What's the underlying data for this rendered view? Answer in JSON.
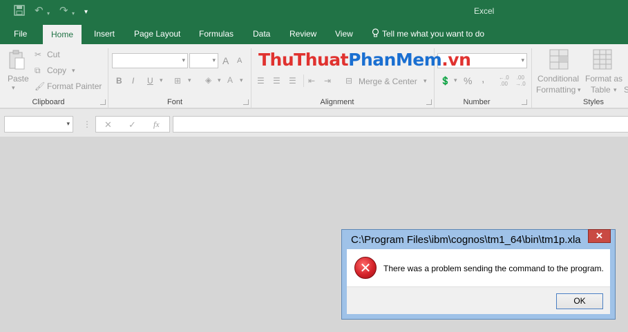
{
  "app": {
    "title": "Excel"
  },
  "qat": {
    "save_icon": "save-icon",
    "undo_icon": "undo-icon",
    "redo_icon": "redo-icon",
    "customize_icon": "customize-qat-icon"
  },
  "tabs": [
    {
      "label": "File"
    },
    {
      "label": "Home"
    },
    {
      "label": "Insert"
    },
    {
      "label": "Page Layout"
    },
    {
      "label": "Formulas"
    },
    {
      "label": "Data"
    },
    {
      "label": "Review"
    },
    {
      "label": "View"
    }
  ],
  "tell_me": "Tell me what you want to do",
  "ribbon": {
    "clipboard": {
      "label": "Clipboard",
      "paste": "Paste",
      "cut": "Cut",
      "copy": "Copy",
      "format_painter": "Format Painter"
    },
    "font": {
      "label": "Font",
      "bold": "B",
      "italic": "I",
      "underline": "U",
      "grow": "A",
      "shrink": "A"
    },
    "alignment": {
      "label": "Alignment",
      "merge_center": "Merge & Center"
    },
    "number": {
      "label": "Number",
      "percent": "%",
      "comma": ","
    },
    "styles": {
      "label": "Styles",
      "conditional_1": "Conditional",
      "conditional_2": "Formatting",
      "format_as_1": "Format as",
      "format_as_2": "Table",
      "cut_off": "S"
    }
  },
  "watermark": {
    "part1": "ThuThuat",
    "part2": "PhanMem",
    "part3": ".vn"
  },
  "formula_bar": {
    "fx": "fx",
    "cancel": "✕",
    "enter": "✓"
  },
  "dialog": {
    "title": "C:\\Program Files\\ibm\\cognos\\tm1_64\\bin\\tm1p.xla",
    "close": "✕",
    "message": "There was a problem sending the command to the program.",
    "ok": "OK",
    "icon": "error-icon"
  },
  "colors": {
    "excel_green": "#217346",
    "dialog_frame": "#9fc2e8",
    "close_red": "#c94a43",
    "error_red": "#d4232a"
  }
}
